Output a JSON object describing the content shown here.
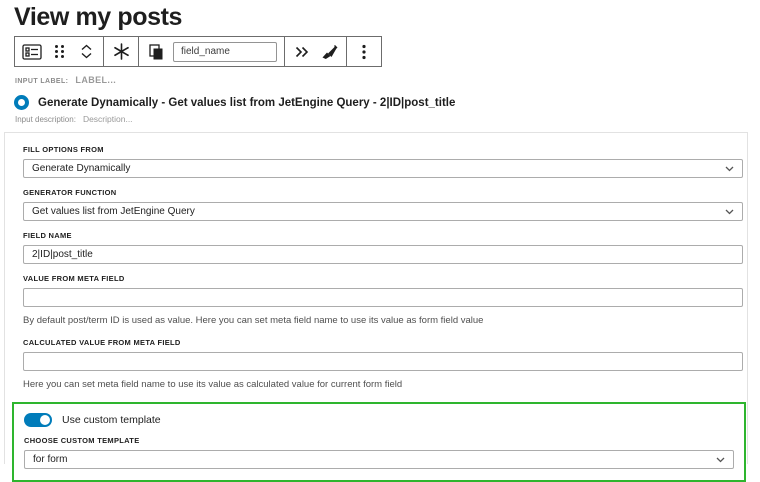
{
  "page": {
    "title": "View my posts"
  },
  "toolbar": {
    "field_name_value": "field_name",
    "icons": [
      "radio-field-block-icon",
      "drag-handle-icon",
      "move-up-down-icon",
      "jetengine-asterisk-icon",
      "duplicate-icon",
      "expand-double-chevron-icon",
      "brush-icon",
      "options-ellipsis-icon"
    ]
  },
  "block": {
    "input_label_prefix": "INPUT LABEL:",
    "input_label_placeholder": "LABEL...",
    "selected_option_label": "Generate Dynamically - Get values list from JetEngine Query - 2|ID|post_title",
    "input_description_prefix": "Input description:",
    "input_description_placeholder": "Description..."
  },
  "form": {
    "fields": [
      {
        "label": "FILL OPTIONS FROM",
        "type": "select",
        "value": "Generate Dynamically"
      },
      {
        "label": "GENERATOR FUNCTION",
        "type": "select",
        "value": "Get values list from JetEngine Query"
      },
      {
        "label": "FIELD NAME",
        "type": "text",
        "value": "2|ID|post_title"
      },
      {
        "label": "VALUE FROM META FIELD",
        "type": "text",
        "value": "",
        "help": "By default post/term ID is used as value. Here you can set meta field name to use its value as form field value"
      },
      {
        "label": "CALCULATED VALUE FROM META FIELD",
        "type": "text",
        "value": "",
        "help": "Here you can set meta field name to use its value as calculated value for current form field"
      }
    ],
    "custom_template": {
      "toggle_label": "Use custom template",
      "toggle_state": "on",
      "label": "CHOOSE CUSTOM TEMPLATE",
      "value": "for form"
    }
  },
  "colors": {
    "accent_blue": "#007cba",
    "highlight_green": "#2eb52e",
    "text_dark": "#1e1e1e",
    "muted_gray": "#8b8b8b"
  }
}
